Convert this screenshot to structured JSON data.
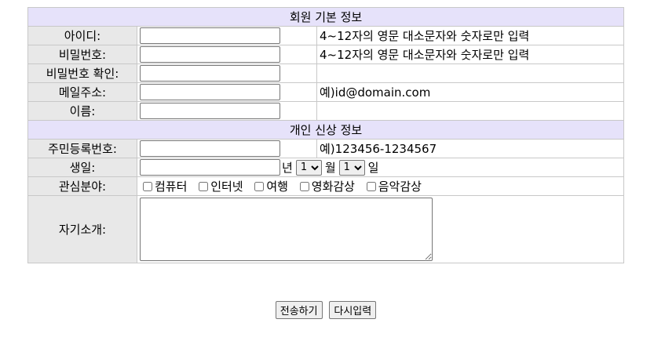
{
  "sections": {
    "basic": "회원 기본 정보",
    "personal": "개인 신상 정보"
  },
  "fields": {
    "id": {
      "label": "아이디:",
      "hint": "4~12자의 영문 대소문자와 숫자로만 입력"
    },
    "password": {
      "label": "비밀번호:",
      "hint": "4~12자의 영문 대소문자와 숫자로만 입력"
    },
    "password_confirm": {
      "label": "비밀번호 확인:"
    },
    "email": {
      "label": "메일주소:",
      "hint": "예)id@domain.com"
    },
    "name": {
      "label": "이름:"
    },
    "rrn": {
      "label": "주민등록번호:",
      "hint": "예)123456-1234567"
    },
    "birthday": {
      "label": "생일:",
      "year_unit": "년",
      "month_value": "1",
      "month_unit": "월",
      "day_value": "1",
      "day_unit": "일"
    },
    "interests": {
      "label": "관심분야:",
      "options": [
        "컴퓨터",
        "인터넷",
        "여행",
        "영화감상",
        "음악감상"
      ]
    },
    "intro": {
      "label": "자기소개:"
    }
  },
  "buttons": {
    "submit": "전송하기",
    "reset": "다시입력"
  }
}
